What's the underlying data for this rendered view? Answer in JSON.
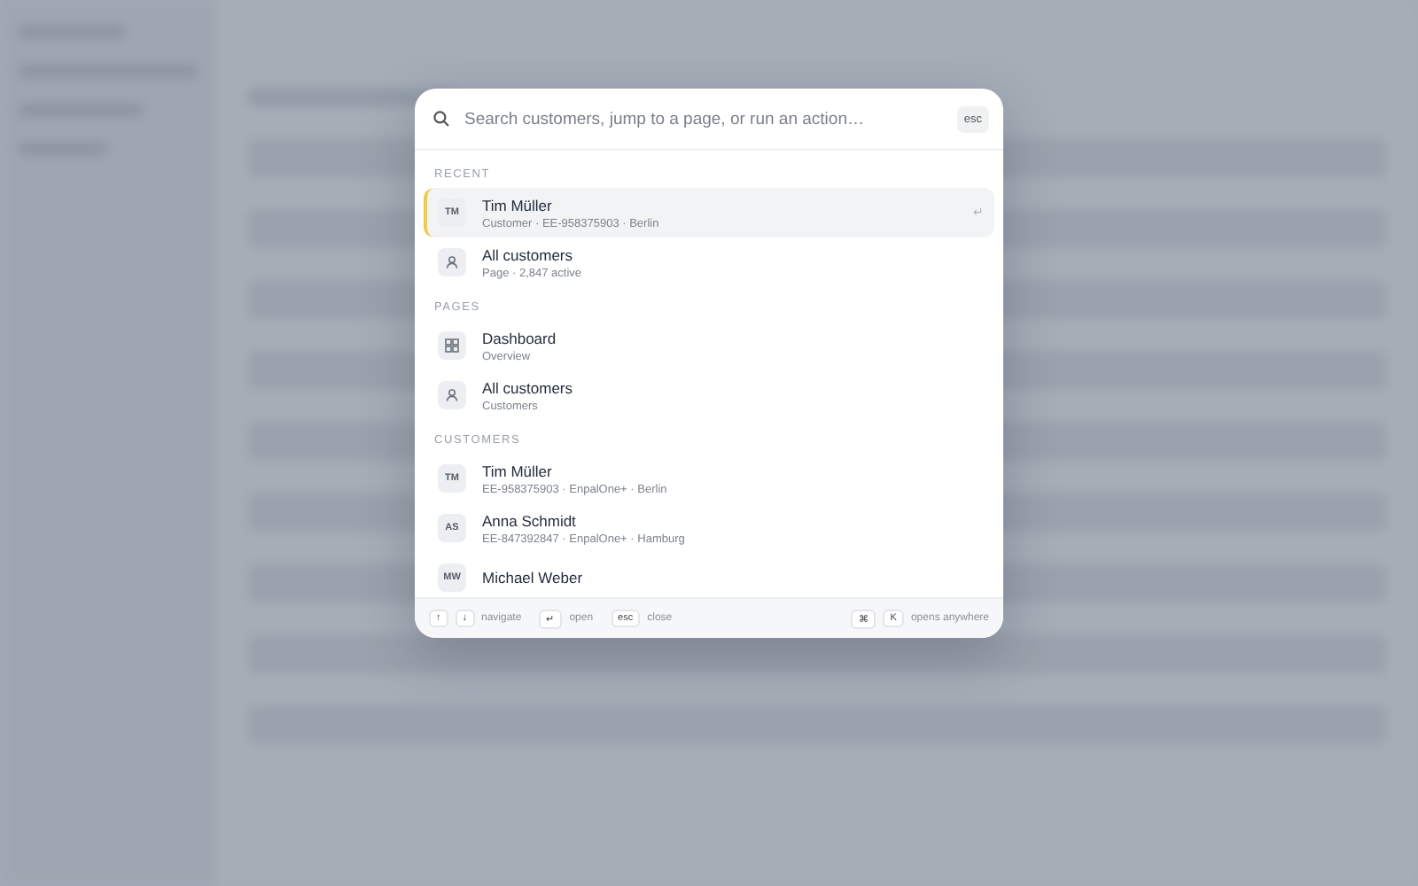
{
  "search": {
    "placeholder": "Search customers, jump to a page, or run an action…",
    "esc_key": "esc"
  },
  "sections": [
    {
      "heading": "RECENT",
      "items": [
        {
          "kind": "initials",
          "initials": "TM",
          "title": "Tim Müller",
          "subtitle": "Customer · EE-958375903 · Berlin",
          "selected": true,
          "hint": "↵"
        },
        {
          "kind": "person",
          "title": "All customers",
          "subtitle": "Page · 2,847 active",
          "selected": false
        }
      ]
    },
    {
      "heading": "PAGES",
      "items": [
        {
          "kind": "grid",
          "title": "Dashboard",
          "subtitle": "Overview",
          "selected": false
        },
        {
          "kind": "person",
          "title": "All customers",
          "subtitle": "Customers",
          "selected": false
        }
      ]
    },
    {
      "heading": "CUSTOMERS",
      "items": [
        {
          "kind": "initials",
          "initials": "TM",
          "title": "Tim Müller",
          "subtitle": "EE-958375903 · EnpalOne+ · Berlin",
          "selected": false
        },
        {
          "kind": "initials",
          "initials": "AS",
          "title": "Anna Schmidt",
          "subtitle": "EE-847392847 · EnpalOne+ · Hamburg",
          "selected": false
        },
        {
          "kind": "initials",
          "initials": "MW",
          "title": "Michael Weber",
          "selected": false
        }
      ]
    }
  ],
  "footer": {
    "hints": [
      {
        "keys": [
          "↑",
          "↓"
        ],
        "label": "navigate"
      },
      {
        "keys": [
          "↵"
        ],
        "label": "open"
      },
      {
        "keys": [
          "esc"
        ],
        "label": "close"
      }
    ],
    "shortcut": {
      "keys": [
        "⌘",
        "K"
      ],
      "label": "opens anywhere"
    }
  }
}
